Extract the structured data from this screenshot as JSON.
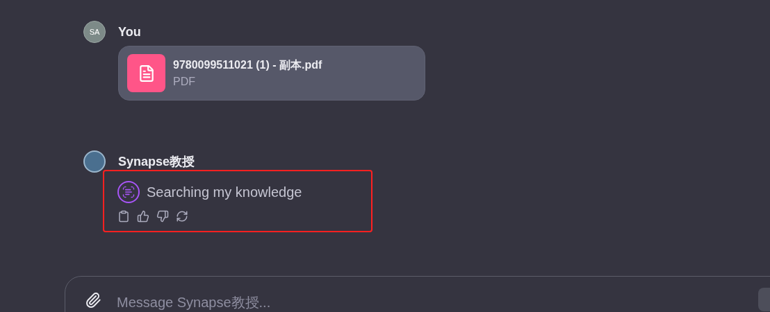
{
  "messages": [
    {
      "kind": "user",
      "avatar": "SA",
      "author": "You",
      "attachment": {
        "name": "9780099511021 (1) - 副本.pdf",
        "type": "PDF"
      }
    },
    {
      "kind": "assistant",
      "author": "Synapse教授",
      "status": "Searching my knowledge",
      "highlighted": true
    }
  ],
  "composer": {
    "placeholder": "Message Synapse教授..."
  }
}
